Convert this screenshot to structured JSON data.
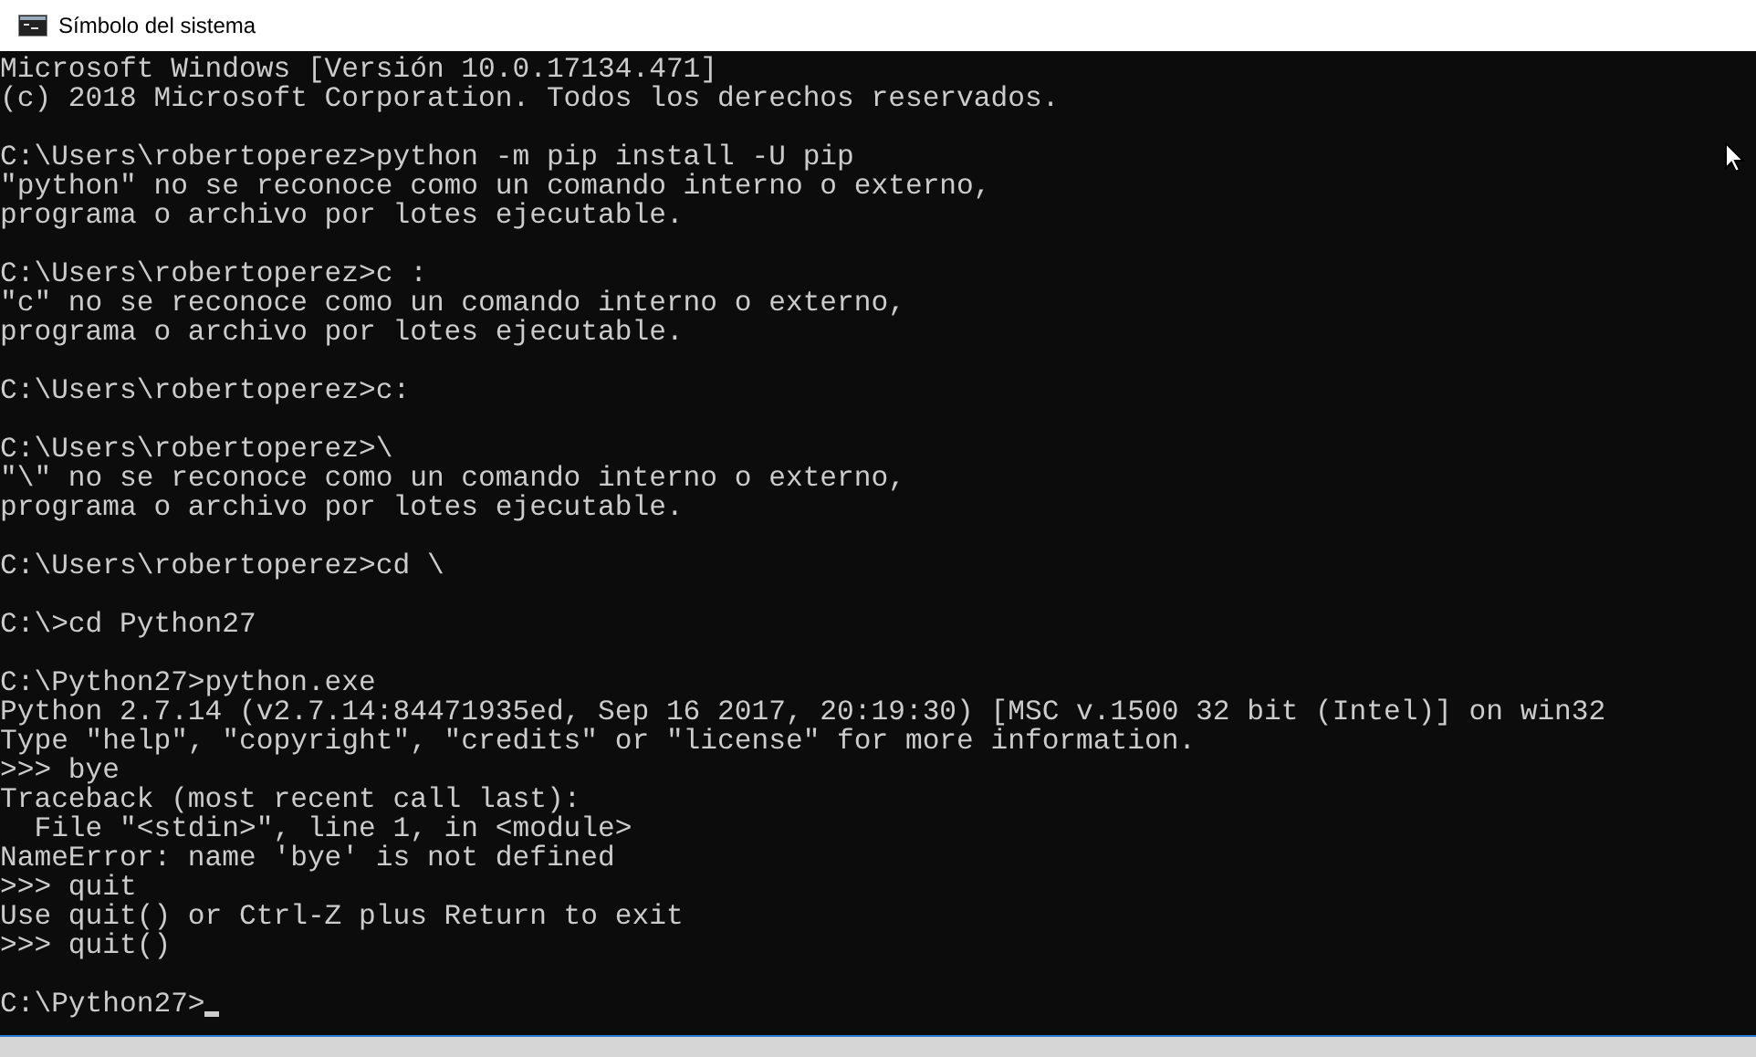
{
  "window": {
    "title": "Símbolo del sistema"
  },
  "console": {
    "blocks": [
      [
        "Microsoft Windows [Versión 10.0.17134.471]",
        "(c) 2018 Microsoft Corporation. Todos los derechos reservados."
      ],
      [
        "C:\\Users\\robertoperez>python -m pip install -U pip",
        "\"python\" no se reconoce como un comando interno o externo,",
        "programa o archivo por lotes ejecutable."
      ],
      [
        "C:\\Users\\robertoperez>c :",
        "\"c\" no se reconoce como un comando interno o externo,",
        "programa o archivo por lotes ejecutable."
      ],
      [
        "C:\\Users\\robertoperez>c:"
      ],
      [
        "C:\\Users\\robertoperez>\\",
        "\"\\\" no se reconoce como un comando interno o externo,",
        "programa o archivo por lotes ejecutable."
      ],
      [
        "C:\\Users\\robertoperez>cd \\"
      ],
      [
        "C:\\>cd Python27"
      ],
      [
        "C:\\Python27>python.exe",
        "Python 2.7.14 (v2.7.14:84471935ed, Sep 16 2017, 20:19:30) [MSC v.1500 32 bit (Intel)] on win32",
        "Type \"help\", \"copyright\", \"credits\" or \"license\" for more information.",
        ">>> bye",
        "Traceback (most recent call last):",
        "  File \"<stdin>\", line 1, in <module>",
        "NameError: name 'bye' is not defined",
        ">>> quit",
        "Use quit() or Ctrl-Z plus Return to exit",
        ">>> quit()"
      ],
      [
        "C:\\Python27>"
      ]
    ]
  }
}
